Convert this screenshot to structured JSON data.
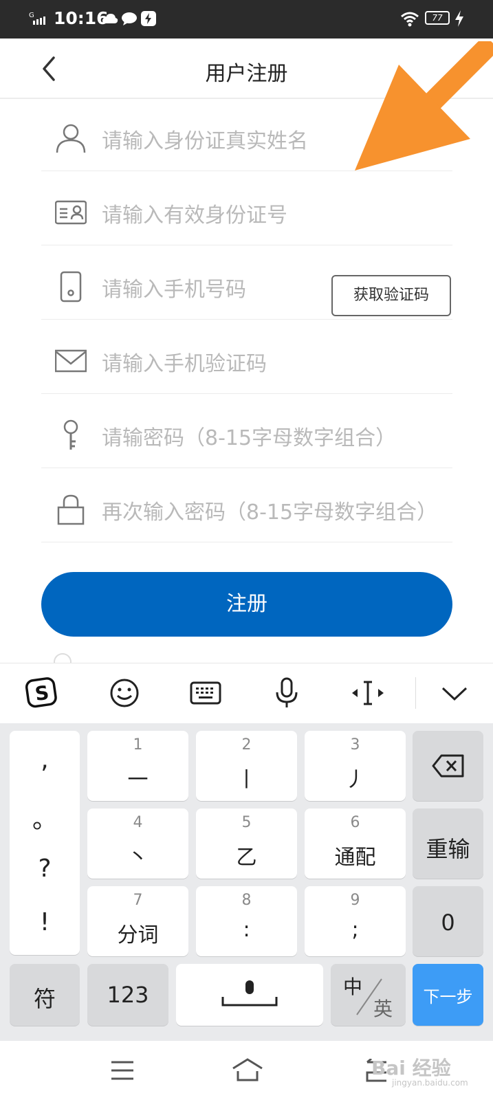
{
  "status_bar": {
    "signal": "G",
    "time": "10:16",
    "battery": "77"
  },
  "header": {
    "title": "用户注册"
  },
  "form": {
    "fields": [
      {
        "placeholder": "请输入身份证真实姓名",
        "icon": "person-icon"
      },
      {
        "placeholder": "请输入有效身份证号",
        "icon": "id-card-icon"
      },
      {
        "placeholder": "请输入手机号码",
        "icon": "phone-icon"
      },
      {
        "placeholder": "请输入手机验证码",
        "icon": "mail-icon"
      },
      {
        "placeholder": "请输密码（8-15字母数字组合）",
        "icon": "key-icon"
      },
      {
        "placeholder": "再次输入密码（8-15字母数字组合）",
        "icon": "lock-icon"
      }
    ],
    "get_code_label": "获取验证码",
    "register_label": "注册"
  },
  "keyboard": {
    "punct": [
      ",",
      "。",
      "?",
      "!"
    ],
    "keys": [
      {
        "num": "1",
        "label": "一"
      },
      {
        "num": "2",
        "label": "丨"
      },
      {
        "num": "3",
        "label": "丿"
      },
      {
        "num": "4",
        "label": "丶"
      },
      {
        "num": "5",
        "label": "乙"
      },
      {
        "num": "6",
        "label": "通配"
      },
      {
        "num": "7",
        "label": "分词"
      },
      {
        "num": "8",
        "label": ":"
      },
      {
        "num": "9",
        "label": ";"
      }
    ],
    "reset_label": "重输",
    "zero_label": "0",
    "symbol_label": "符",
    "num_label": "123",
    "lang_zh": "中",
    "lang_en": "英",
    "next_label": "下一步"
  },
  "watermark": {
    "text": "Bai 经验",
    "sub": "jingyan.baidu.com"
  },
  "colors": {
    "accent": "#0066bf",
    "next_key": "#3d9cf6",
    "arrow": "#f7922e"
  }
}
